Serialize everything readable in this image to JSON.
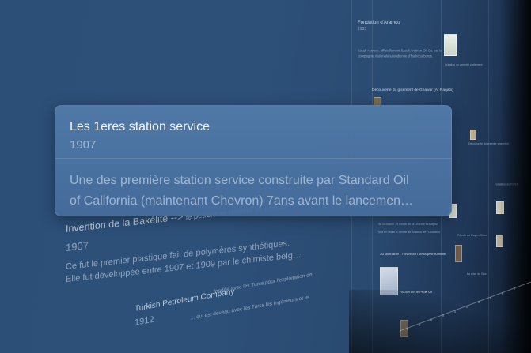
{
  "popup": {
    "title": "Les 1eres station service",
    "year": "1907",
    "description_line1": "Une des première station service construite par Standard Oil",
    "description_line2": "of California (maintenant Chevron) 7ans avant le lancemen…"
  },
  "bakelite": {
    "title_main": "Invention de la Bakélite",
    "title_arrow": " --> ",
    "title_rest": "le pétrole se répend de partout",
    "year": "1907",
    "line1": "Ce fut le premier plastique fait de polymères synthétiques.",
    "line2": "Elle fut développée entre 1907 et 1909 par le chimiste belg…"
  },
  "turkish": {
    "title": "Turkish Petroleum Company",
    "year": "1912",
    "snippet1": "fondée avec les Turcs pour l'exploitation de",
    "snippet2": "… qui est devenu avec les Turcs les ingénieurs et le"
  },
  "background": {
    "col1": {
      "title": "Fondation d'Aramco",
      "year": "1933",
      "text1": "Saudi Aramco, officiellement Saudi Arabian Oil Co. est la",
      "text2": "compagnie nationale saoudienne d'hydrocarbures.",
      "item2": "Découverte du gisement de Ghawar (Ar Raqabi)",
      "item3": "40 Birmanie - Il existe de la Grande Bretagne",
      "item4": "Tout en étant le centre de Aramco de l'Occident",
      "item5": "30 Birmanie : l'invention de la pétrochimie",
      "item6": "Hubbert et le Peak Oil"
    },
    "col2": {
      "text1": "Création du premier parlement",
      "text2": "Découverte du premier gisement",
      "text3": "Pétrole au Moyen-Orient",
      "text4": "La crise de Suez",
      "text5": "Fondation de l'OPEP"
    }
  }
}
